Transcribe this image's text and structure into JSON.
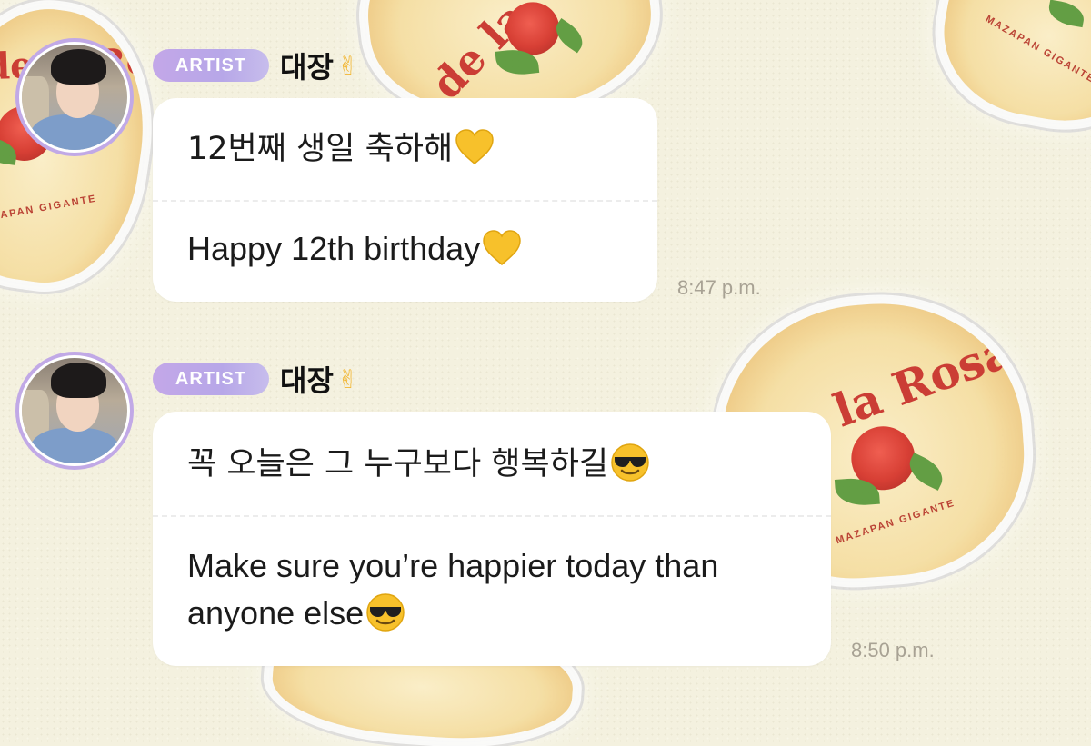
{
  "background": {
    "color": "#f4f1df",
    "candy_brand": "de la Rosa",
    "candy_brand_short": "de la",
    "candy_subtitle": "MAZAPAN GIGANTE"
  },
  "badge_color": "#c1a9e6",
  "messages": [
    {
      "sender_badge": "ARTIST",
      "sender_name": "대장",
      "sender_emoji": "victory-hand",
      "text_korean": "12번째 생일 축하해",
      "text_english": "Happy 12th birthday",
      "emoji": "yellow-heart",
      "time": "8:47 p.m."
    },
    {
      "sender_badge": "ARTIST",
      "sender_name": "대장",
      "sender_emoji": "victory-hand",
      "text_korean": "꼭 오늘은 그 누구보다 행복하길",
      "text_english": "Make sure you’re happier today than anyone else",
      "emoji": "smiling-face-with-sunglasses",
      "time": "8:50 p.m."
    }
  ]
}
